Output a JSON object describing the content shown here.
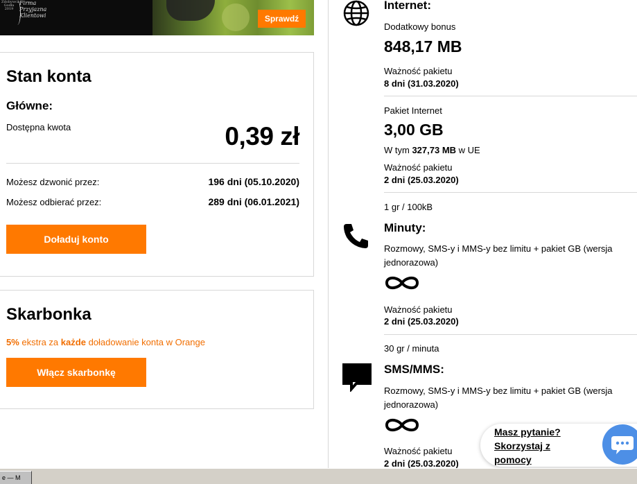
{
  "banner": {
    "award_small": "Zdobywca Godła 2019",
    "award_text": "Firma Przyjazna Klientowi",
    "cta": "Sprawdź"
  },
  "account": {
    "title": "Stan konta",
    "main_label": "Główne:",
    "available_label": "Dostępna kwota",
    "amount": "0,39 zł",
    "call_label": "Możesz dzwonić przez:",
    "call_value": "196 dni (05.10.2020)",
    "receive_label": "Możesz odbierać przez:",
    "receive_value": "289 dni (06.01.2021)",
    "topup_button": "Doładuj konto"
  },
  "piggybank": {
    "title": "Skarbonka",
    "promo_percent": "5%",
    "promo_mid": "ekstra za",
    "promo_bold": "każde",
    "promo_end": "doładowanie konta w Orange",
    "button": "Włącz skarbonkę"
  },
  "internet": {
    "title": "Internet:",
    "bonus_label": "Dodatkowy bonus",
    "bonus_value": "848,17 MB",
    "bonus_validity_label": "Ważność pakietu",
    "bonus_validity_value": "8 dni (31.03.2020)",
    "pkg_label": "Pakiet Internet",
    "pkg_value": "3,00 GB",
    "eu_prefix": "W tym",
    "eu_value": "327,73 MB",
    "eu_suffix": "w UE",
    "pkg_validity_label": "Ważność pakietu",
    "pkg_validity_value": "2 dni (25.03.2020)",
    "rate": "1 gr / 100kB"
  },
  "minutes": {
    "title": "Minuty:",
    "description": "Rozmowy, SMS-y i MMS-y bez limitu + pakiet GB (wersja jednorazowa)",
    "validity_label": "Ważność pakietu",
    "validity_value": "2 dni (25.03.2020)",
    "rate": "30 gr / minuta"
  },
  "sms": {
    "title": "SMS/MMS:",
    "description": "Rozmowy, SMS-y i MMS-y bez limitu + pakiet GB (wersja jednorazowa)",
    "validity_label": "Ważność pakietu",
    "validity_value": "2 dni (25.03.2020)"
  },
  "help": {
    "line1": "Masz pytanie?",
    "line2": "Skorzystaj z",
    "line3": "pomocy"
  },
  "taskbar": {
    "item": "e — M"
  },
  "colors": {
    "orange": "#ff7900",
    "orange_text": "#f16e00",
    "chat_blue": "#4d8fe6"
  }
}
